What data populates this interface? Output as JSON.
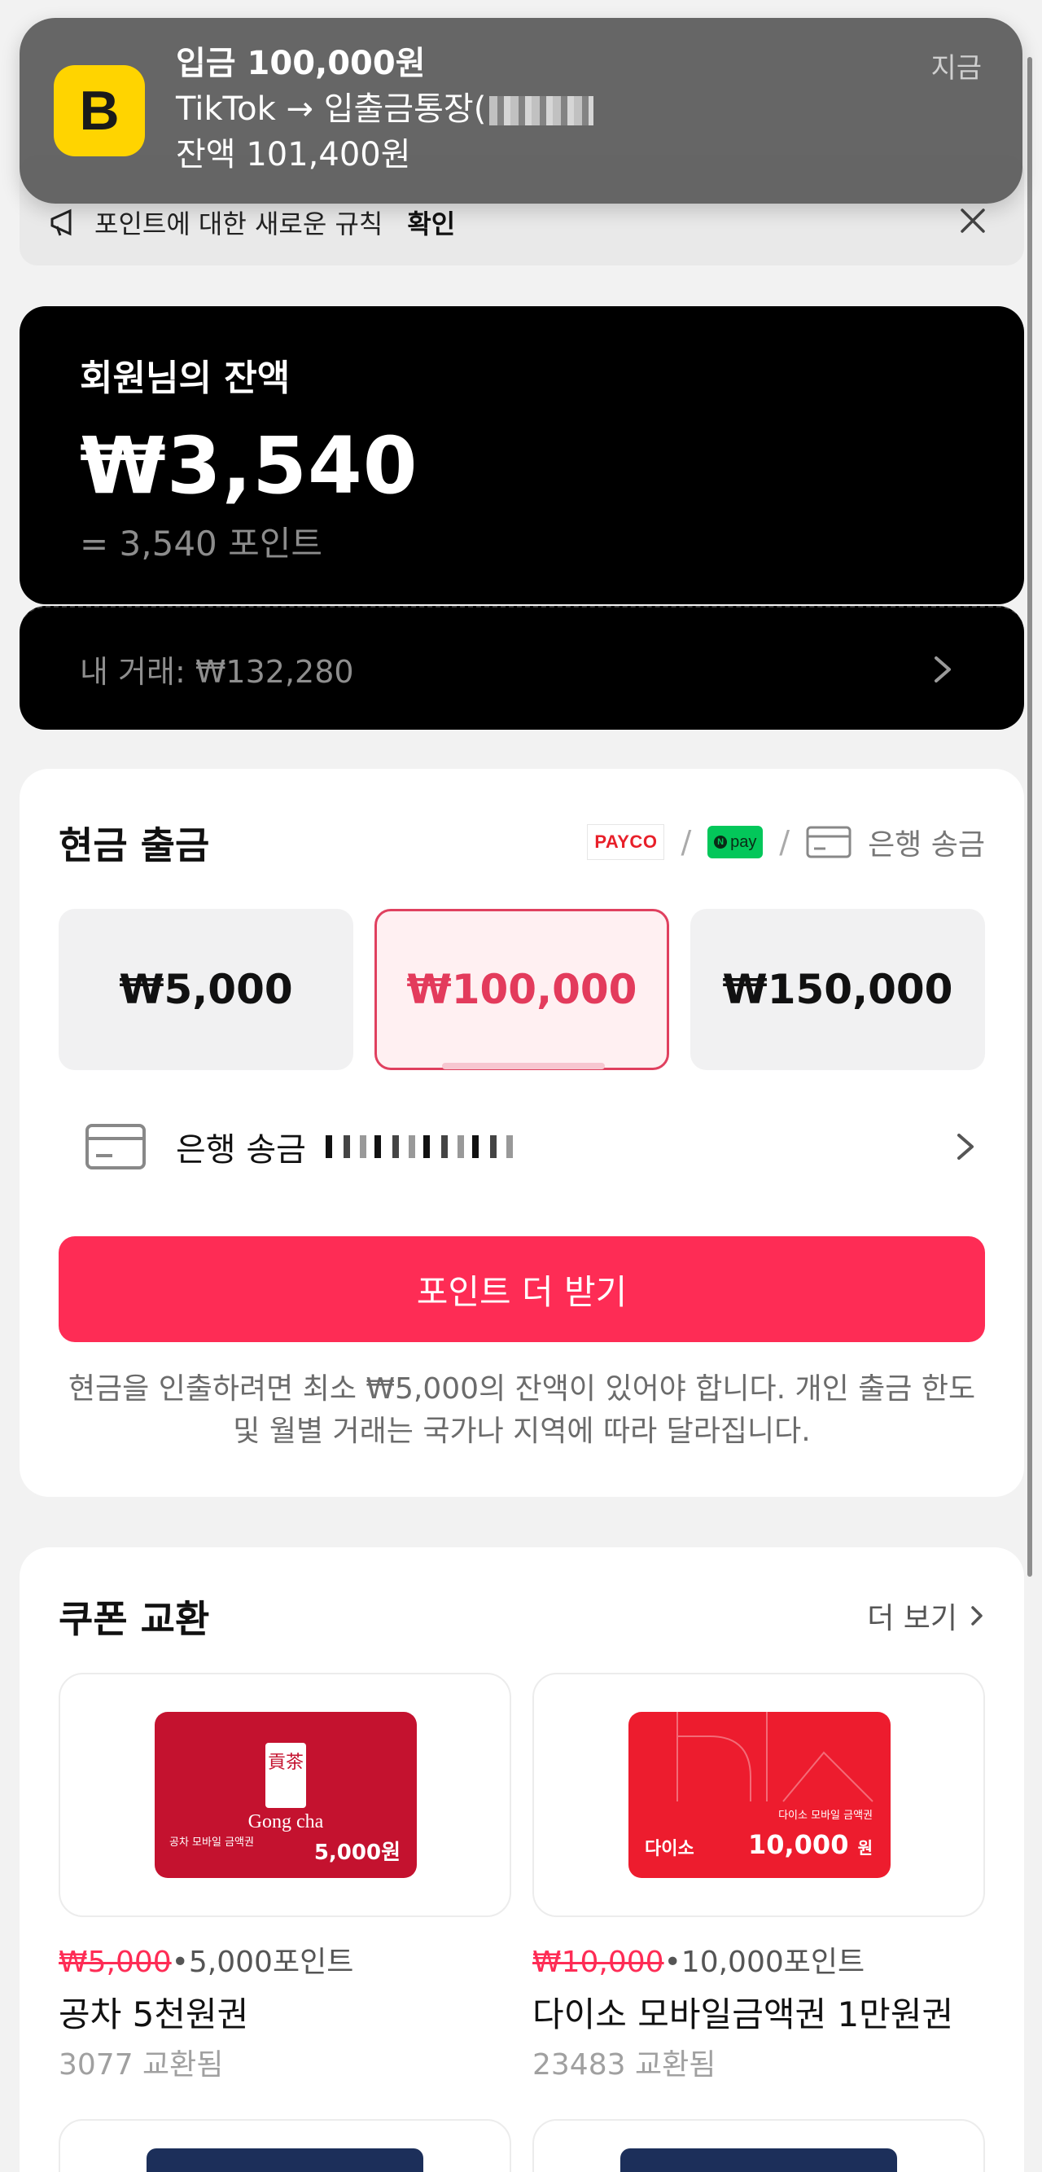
{
  "notification": {
    "app_icon": "B",
    "title": "입금 100,000원",
    "line2": "TikTok → 입출금통장(",
    "line3": "잔액 101,400원",
    "time": "지금"
  },
  "rule_banner": {
    "text": "포인트에 대한 새로운 규칙",
    "link": "확인"
  },
  "balance": {
    "label": "회원님의 잔액",
    "amount": "₩3,540",
    "points": "= 3,540 포인트",
    "transactions": "내 거래: ₩132,280"
  },
  "cash": {
    "title": "현금 출금",
    "payco": "PAYCO",
    "npay": "pay",
    "bank_method": "은행 송금",
    "amounts": [
      "₩5,000",
      "₩100,000",
      "₩150,000"
    ],
    "selected_amount": "₩100,000",
    "bank_row_label": "은행 송금",
    "more_button": "포인트 더 받기",
    "note": "현금을 인출하려면 최소 ₩5,000의 잔액이 있어야 합니다. 개인 출금 한도 및 월별 거래는 국가나 지역에 따라 달라집니다."
  },
  "coupons": {
    "title": "쿠폰 교환",
    "more": "더 보기",
    "items": [
      {
        "card_brand": "Gong cha",
        "card_logo": "貢茶",
        "card_small": "공차 모바일 금액권",
        "card_value": "5,000원",
        "old_price": "₩5,000",
        "points": "•5,000포인트",
        "name": "공차 5천원권",
        "count": "3077 교환됨"
      },
      {
        "card_brand": "다이소",
        "card_small": "다이소 모바일 금액권",
        "card_value": "10,000",
        "card_unit": "원",
        "old_price": "₩10,000",
        "points": "•10,000포인트",
        "name": "다이소 모바일금액권 1만원권",
        "count": "23483 교환됨"
      }
    ]
  },
  "colors": {
    "accent": "#fe2c55",
    "notification_icon": "#ffd400",
    "card_bg": "#000000"
  }
}
